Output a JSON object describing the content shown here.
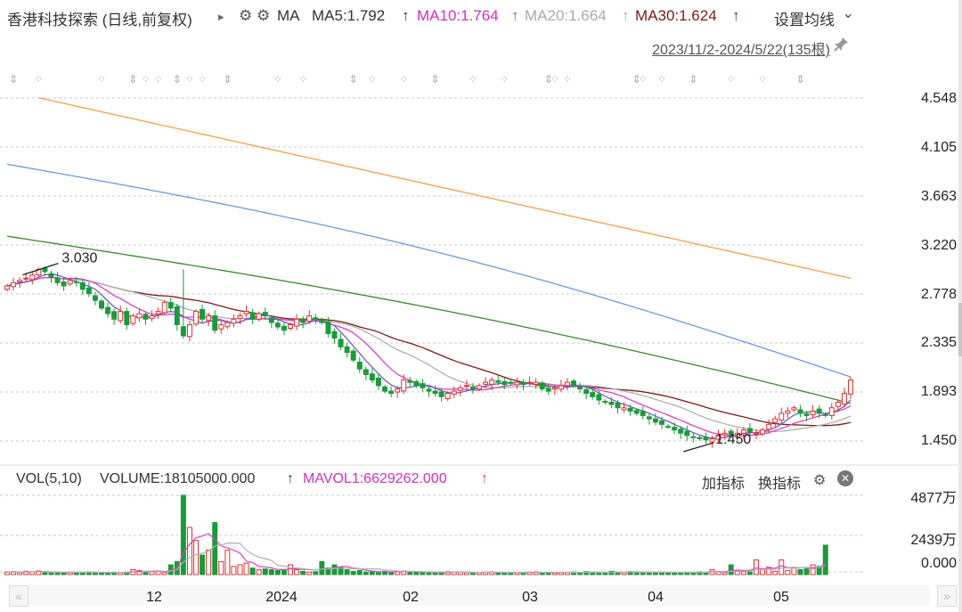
{
  "header": {
    "title": "香港科技探索 (日线,前复权)",
    "play_icon": "▸",
    "gear_icon": "⚙",
    "ma_label": "MA",
    "ma5": "MA5:1.792",
    "ma10": "MA10:1.764",
    "ma20": "MA20:1.664",
    "ma30": "MA30:1.624",
    "arrow_up": "↑",
    "settings": "设置均线",
    "settings_chevron": "⌄",
    "range": "2023/11/2-2024/5/22(135根)",
    "pin_icon": "📌"
  },
  "volume_header": {
    "vol": "VOL(5,10)",
    "volume": "VOLUME:18105000.000",
    "mavol1": "MAVOL1:6629262.000",
    "arrow_up": "↑",
    "add_indicator": "加指标",
    "switch_indicator": "换指标",
    "gear_icon": "⚙",
    "close_icon": "✕"
  },
  "colors": {
    "up": "#e03030",
    "down": "#1a9a3a",
    "ma5": "#e040c0",
    "ma10": "#b0b0b0",
    "ma20": "#7a1a1a",
    "ma60": "#3a8a2a",
    "ma120": "#6a9adf",
    "ma250": "#f0a040"
  },
  "chart_data": [
    {
      "type": "candlestick",
      "title": "香港科技探索 (日线,前复权)",
      "period": "2023/11/2-2024/5/22",
      "bars": 135,
      "y_ticks": [
        "4.548",
        "4.105",
        "3.663",
        "3.220",
        "2.778",
        "2.335",
        "1.893",
        "1.450"
      ],
      "ylim": [
        1.4,
        4.6
      ],
      "x_ticks": [
        "12",
        "2024",
        "02",
        "03",
        "04",
        "05"
      ],
      "annotations": [
        {
          "label": "3.030",
          "type": "high"
        },
        {
          "label": "1.450",
          "type": "low"
        }
      ],
      "close": [
        2.85,
        2.88,
        2.9,
        2.92,
        2.95,
        3.0,
        2.98,
        2.93,
        2.88,
        2.85,
        2.9,
        2.88,
        2.82,
        2.78,
        2.72,
        2.65,
        2.6,
        2.55,
        2.62,
        2.5,
        2.58,
        2.6,
        2.55,
        2.58,
        2.62,
        2.7,
        2.65,
        2.5,
        2.4,
        2.5,
        2.62,
        2.55,
        2.58,
        2.45,
        2.5,
        2.52,
        2.55,
        2.58,
        2.62,
        2.55,
        2.6,
        2.58,
        2.52,
        2.48,
        2.45,
        2.5,
        2.55,
        2.52,
        2.58,
        2.55,
        2.52,
        2.42,
        2.38,
        2.3,
        2.25,
        2.18,
        2.1,
        2.05,
        2.0,
        1.95,
        1.9,
        1.88,
        1.92,
        2.0,
        1.98,
        1.95,
        1.93,
        1.9,
        1.88,
        1.85,
        1.88,
        1.9,
        1.93,
        1.95,
        1.92,
        1.95,
        1.98,
        2.0,
        1.98,
        1.96,
        1.97,
        1.98,
        1.96,
        1.98,
        1.98,
        1.92,
        1.9,
        1.93,
        1.95,
        1.98,
        1.95,
        1.92,
        1.88,
        1.85,
        1.82,
        1.8,
        1.78,
        1.75,
        1.75,
        1.72,
        1.7,
        1.68,
        1.65,
        1.62,
        1.6,
        1.58,
        1.55,
        1.52,
        1.5,
        1.48,
        1.47,
        1.46,
        1.47,
        1.5,
        1.52,
        1.5,
        1.52,
        1.55,
        1.53,
        1.52,
        1.55,
        1.6,
        1.65,
        1.7,
        1.72,
        1.75,
        1.7,
        1.68,
        1.72,
        1.7,
        1.68,
        1.75,
        1.8,
        1.88,
        2.0
      ],
      "volume": {
        "y_ticks": [
          "4877万",
          "2439万",
          "0.000"
        ],
        "unit": "万",
        "ylim": [
          0,
          4877
        ],
        "values": [
          150,
          180,
          120,
          200,
          160,
          220,
          140,
          100,
          90,
          120,
          150,
          130,
          110,
          160,
          140,
          120,
          130,
          140,
          110,
          150,
          300,
          250,
          180,
          160,
          200,
          140,
          600,
          800,
          4877,
          2900,
          2100,
          1200,
          1500,
          3200,
          800,
          1500,
          500,
          600,
          700,
          400,
          300,
          350,
          300,
          250,
          280,
          600,
          300,
          200,
          150,
          180,
          800,
          400,
          600,
          450,
          300,
          200,
          250,
          150,
          180,
          120,
          200,
          150,
          180,
          220,
          200,
          150,
          120,
          100,
          120,
          150,
          180,
          160,
          140,
          120,
          100,
          120,
          150,
          160,
          120,
          100,
          140,
          120,
          100,
          150,
          160,
          120,
          140,
          100,
          120,
          130,
          150,
          120,
          180,
          140,
          120,
          100,
          200,
          150,
          120,
          180,
          160,
          140,
          120,
          150,
          130,
          120,
          100,
          120,
          150,
          140,
          160,
          130,
          300,
          150,
          120,
          600,
          200,
          180,
          150,
          900,
          300,
          450,
          200,
          900,
          250,
          400,
          300,
          350,
          600,
          500,
          1810
        ],
        "mavol1": 662.9
      }
    }
  ]
}
